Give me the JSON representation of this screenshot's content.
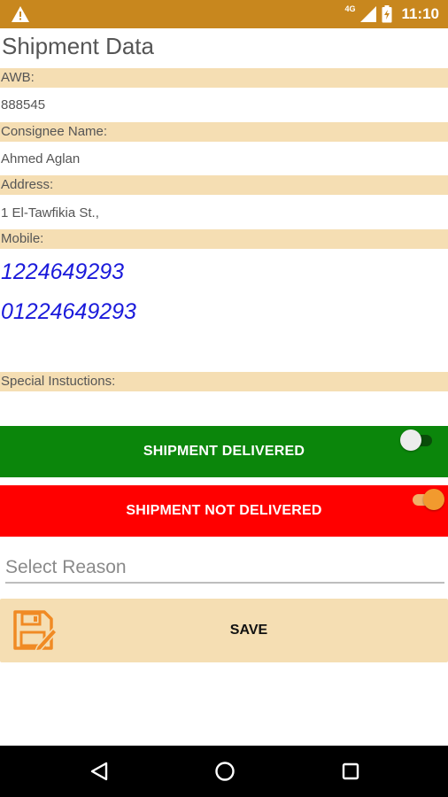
{
  "status_bar": {
    "network": "4G",
    "time": "11:10"
  },
  "page": {
    "title": "Shipment Data"
  },
  "fields": {
    "awb_label": "AWB:",
    "awb_value": "888545",
    "consignee_label": "Consignee Name:",
    "consignee_value": "Ahmed Aglan",
    "address_label": "Address:",
    "address_value": "1 El-Tawfikia St.,",
    "mobile_label": "Mobile:",
    "mobile_values": [
      "1224649293",
      "01224649293"
    ],
    "special_label": "Special Instuctions:"
  },
  "actions": {
    "delivered_label": "SHIPMENT DELIVERED",
    "delivered_toggle_on": false,
    "not_delivered_label": "SHIPMENT NOT DELIVERED",
    "not_delivered_toggle_on": true,
    "reason_placeholder": "Select Reason",
    "save_label": "SAVE"
  },
  "colors": {
    "status_bar": "#c8871e",
    "label_bg": "#f5deb3",
    "delivered_green": "#0b860b",
    "not_delivered_red": "#ff0000",
    "phone_blue": "#1a1adb",
    "toggle_orange": "#f29a2e"
  },
  "icons": {
    "warning": "warning-icon",
    "signal": "signal-icon",
    "battery": "battery-icon",
    "save": "save-floppy-icon",
    "nav_back": "back-triangle-icon",
    "nav_home": "home-circle-icon",
    "nav_recent": "recent-square-icon"
  }
}
